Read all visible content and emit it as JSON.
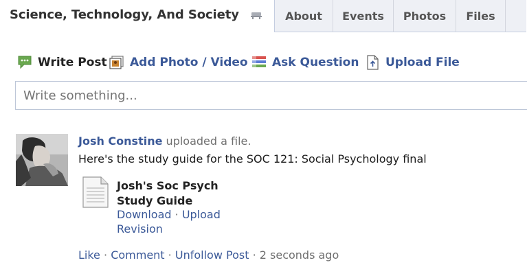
{
  "header": {
    "group_title": "Science, Technology, And Society",
    "tabs": [
      {
        "label": "About"
      },
      {
        "label": "Events"
      },
      {
        "label": "Photos"
      },
      {
        "label": "Files"
      }
    ]
  },
  "composer": {
    "actions": [
      {
        "label": "Write Post",
        "icon": "speech-bubble-icon"
      },
      {
        "label": "Add Photo / Video",
        "icon": "photo-icon"
      },
      {
        "label": "Ask Question",
        "icon": "question-poll-icon"
      },
      {
        "label": "Upload File",
        "icon": "upload-file-icon"
      }
    ],
    "placeholder": "Write something..."
  },
  "story": {
    "author": "Josh Constine",
    "verb": "uploaded a file.",
    "message": "Here's the study guide for the SOC 121: Social Psychology final",
    "file": {
      "title": "Josh's Soc Psych Study Guide",
      "download": "Download",
      "separator": "·",
      "upload_revision": "Upload Revision"
    },
    "footer": {
      "like": "Like",
      "comment": "Comment",
      "unfollow": "Unfollow Post",
      "separator": "·",
      "timestamp": "2 seconds ago"
    }
  },
  "colors": {
    "link": "#3b5998",
    "tab_bg": "#eef0f5",
    "border": "#bdc7d8",
    "muted": "#6f6f6f",
    "write_post_green": "#6aa84f"
  }
}
